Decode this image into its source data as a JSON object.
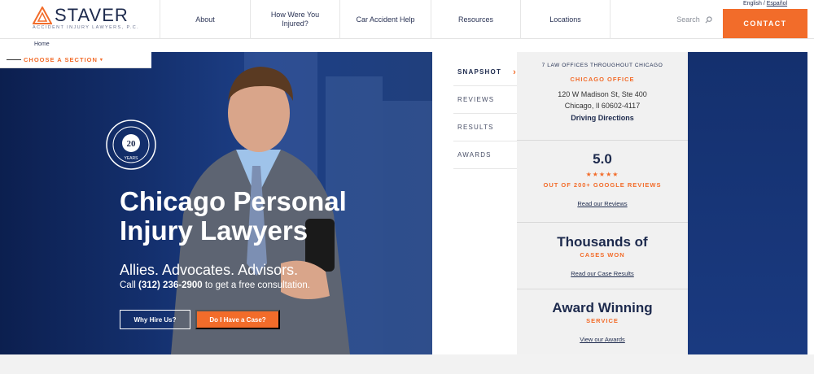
{
  "header": {
    "logo_text": "STAVER",
    "logo_sub": "ACCIDENT INJURY LAWYERS, P.C.",
    "nav": [
      {
        "label": "About",
        "name": "nav-about"
      },
      {
        "label": "How Were You Injured?",
        "name": "nav-how-injured"
      },
      {
        "label": "Car Accident Help",
        "name": "nav-car-accident"
      },
      {
        "label": "Resources",
        "name": "nav-resources"
      },
      {
        "label": "Locations",
        "name": "nav-locations"
      }
    ],
    "search_label": "Search",
    "lang_english": "English",
    "lang_sep": " / ",
    "lang_spanish": "Español",
    "contact_label": "CONTACT"
  },
  "breadcrumb": "Home",
  "choose_section": "CHOOSE A SECTION",
  "hero": {
    "badge_years": "20",
    "badge_text": "YEARS",
    "title_line1": "Chicago Personal",
    "title_line2": "Injury Lawyers",
    "subtitle": "Allies. Advocates. Advisors.",
    "call_prefix": "Call ",
    "phone": "(312) 236-2900",
    "call_suffix": " to get a free consultation.",
    "btn_why": "Why Hire Us?",
    "btn_case": "Do I Have a Case?"
  },
  "tabs": [
    {
      "label": "SNAPSHOT",
      "active": true
    },
    {
      "label": "REVIEWS",
      "active": false
    },
    {
      "label": "RESULTS",
      "active": false
    },
    {
      "label": "AWARDS",
      "active": false
    }
  ],
  "info": {
    "offices": "7 LAW OFFICES THROUGHOUT CHICAGO",
    "office_name": "CHICAGO OFFICE",
    "addr1": "120 W Madison St, Ste 400",
    "addr2": "Chicago, Il 60602-4117",
    "directions": "Driving Directions",
    "rating": "5.0",
    "stars": "★★★★★",
    "reviews_caption": "OUT OF 200+ GOOGLE REVIEWS",
    "reviews_link": "Read our Reviews",
    "cases_title": "Thousands of",
    "cases_caption": "CASES WON",
    "cases_link": "Read our Case Results",
    "award_title": "Award Winning",
    "award_caption": "SERVICE",
    "award_link": "View our Awards"
  },
  "colors": {
    "accent": "#f26c2a",
    "navy": "#1d2a4d",
    "hero_blue": "#14306e"
  }
}
